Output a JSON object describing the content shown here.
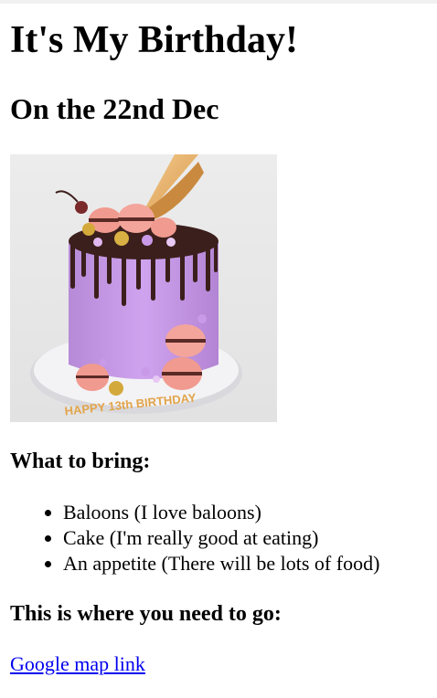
{
  "page": {
    "title": "It's My Birthday!",
    "subtitle": "On the 22nd Dec"
  },
  "cake_image": {
    "icon": "birthday-cake-image",
    "inscription": "HAPPY 13th BIRTHDAY"
  },
  "bring": {
    "heading": "What to bring:",
    "items": [
      "Baloons (I love baloons)",
      "Cake (I'm really good at eating)",
      "An appetite (There will be lots of food)"
    ]
  },
  "directions": {
    "heading": "This is where you need to go:",
    "link_label": "Google map link"
  },
  "colors": {
    "link": "#0000ee",
    "cake_purple": "#c79be6",
    "macaron_pink": "#f0918a",
    "cone": "#e9b56b"
  }
}
